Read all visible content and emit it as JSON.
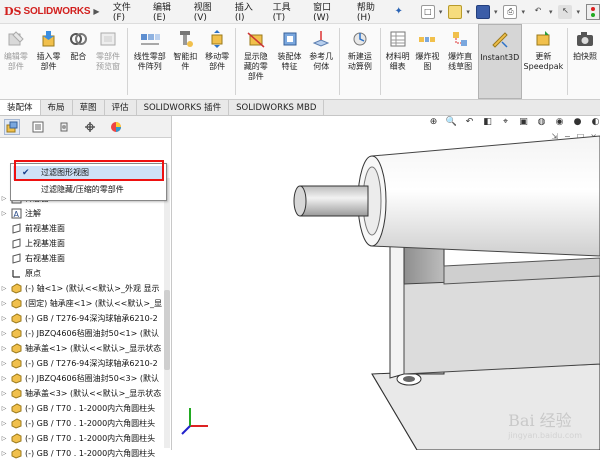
{
  "app": {
    "logo_mark": "DS",
    "logo_text": "SOLIDWORKS",
    "menus": [
      "文件(F)",
      "编辑(E)",
      "视图(V)",
      "插入(I)",
      "工具(T)",
      "窗口(W)",
      "帮助(H)"
    ]
  },
  "commands": [
    {
      "label": "编辑零\n部件",
      "icon": "edit-component-icon",
      "dim": true
    },
    {
      "label": "插入零\n部件",
      "icon": "insert-component-icon",
      "dim": false
    },
    {
      "label": "配合",
      "icon": "mate-icon",
      "dim": false
    },
    {
      "label": "零部件\n预览窗",
      "icon": "component-preview-icon",
      "dim": true
    },
    {
      "label": "线性零部\n件阵列",
      "icon": "linear-pattern-icon",
      "dim": false
    },
    {
      "label": "智能扣\n件",
      "icon": "smart-fastener-icon",
      "dim": false
    },
    {
      "label": "移动零\n部件",
      "icon": "move-component-icon",
      "dim": false
    },
    {
      "label": "显示隐\n藏的零\n部件",
      "icon": "show-hidden-icon",
      "dim": false
    },
    {
      "label": "装配体\n特征",
      "icon": "assembly-feature-icon",
      "dim": false
    },
    {
      "label": "参考几\n何体",
      "icon": "reference-geometry-icon",
      "dim": false
    },
    {
      "label": "新建运\n动算例",
      "icon": "motion-study-icon",
      "dim": false
    },
    {
      "label": "材料明\n细表",
      "icon": "bom-icon",
      "dim": false
    },
    {
      "label": "爆炸视\n图",
      "icon": "exploded-view-icon",
      "dim": false
    },
    {
      "label": "爆炸直\n线草图",
      "icon": "explode-line-sketch-icon",
      "dim": false
    },
    {
      "label": "Instant3D",
      "icon": "instant3d-icon",
      "dim": false,
      "active": true
    },
    {
      "label": "更新\nSpeedpak",
      "icon": "speedpak-icon",
      "dim": false
    },
    {
      "label": "拍快照",
      "icon": "snapshot-icon",
      "dim": false
    }
  ],
  "tabs": [
    "装配体",
    "布局",
    "草图",
    "评估",
    "SOLIDWORKS 插件",
    "SOLIDWORKS MBD"
  ],
  "dropdown": {
    "items": [
      {
        "label": "过滤图形视图",
        "checked": true
      },
      {
        "label": "过滤隐藏/压缩的零部件",
        "checked": false
      }
    ]
  },
  "tree": [
    {
      "label": "传感器",
      "icon": "sensor-icon",
      "exp": "▷"
    },
    {
      "label": "注解",
      "icon": "annotation-icon",
      "exp": "▷"
    },
    {
      "label": "前视基准面",
      "icon": "plane-icon",
      "exp": ""
    },
    {
      "label": "上视基准面",
      "icon": "plane-icon",
      "exp": ""
    },
    {
      "label": "右视基准面",
      "icon": "plane-icon",
      "exp": ""
    },
    {
      "label": "原点",
      "icon": "origin-icon",
      "exp": ""
    },
    {
      "label": "(-) 轴<1> (默认<<默认>_外观 显示",
      "icon": "part-icon",
      "exp": "▷"
    },
    {
      "label": "(固定) 轴承座<1> (默认<<默认>_显",
      "icon": "part-icon",
      "exp": "▷"
    },
    {
      "label": "(-) GB / T276-94深沟球轴承6210-2",
      "icon": "part-icon",
      "exp": "▷"
    },
    {
      "label": "(-) JBZQ4606毡圈油封50<1> (默认",
      "icon": "part-icon",
      "exp": "▷"
    },
    {
      "label": "轴承盖<1> (默认<<默认>_显示状态",
      "icon": "part-icon",
      "exp": "▷"
    },
    {
      "label": "(-) GB / T276-94深沟球轴承6210-2",
      "icon": "part-icon",
      "exp": "▷"
    },
    {
      "label": "(-) JBZQ4606毡圈油封50<3> (默认",
      "icon": "part-icon",
      "exp": "▷"
    },
    {
      "label": "轴承盖<3> (默认<<默认>_显示状态",
      "icon": "part-icon",
      "exp": "▷"
    },
    {
      "label": "(-) GB / T70 . 1-2000内六角圆柱头",
      "icon": "part-icon",
      "exp": "▷"
    },
    {
      "label": "(-) GB / T70 . 1-2000内六角圆柱头",
      "icon": "part-icon",
      "exp": "▷"
    },
    {
      "label": "(-) GB / T70 . 1-2000内六角圆柱头",
      "icon": "part-icon",
      "exp": "▷"
    },
    {
      "label": "(-) GB / T70 . 1-2000内六角圆柱头",
      "icon": "part-icon",
      "exp": "▷"
    }
  ],
  "watermark": {
    "main": "Bai 经验",
    "sub": "jingyan.baidu.com"
  },
  "colors": {
    "brand": "#d2201e",
    "highlight": "#e11111",
    "selection": "#cfe1f7"
  }
}
